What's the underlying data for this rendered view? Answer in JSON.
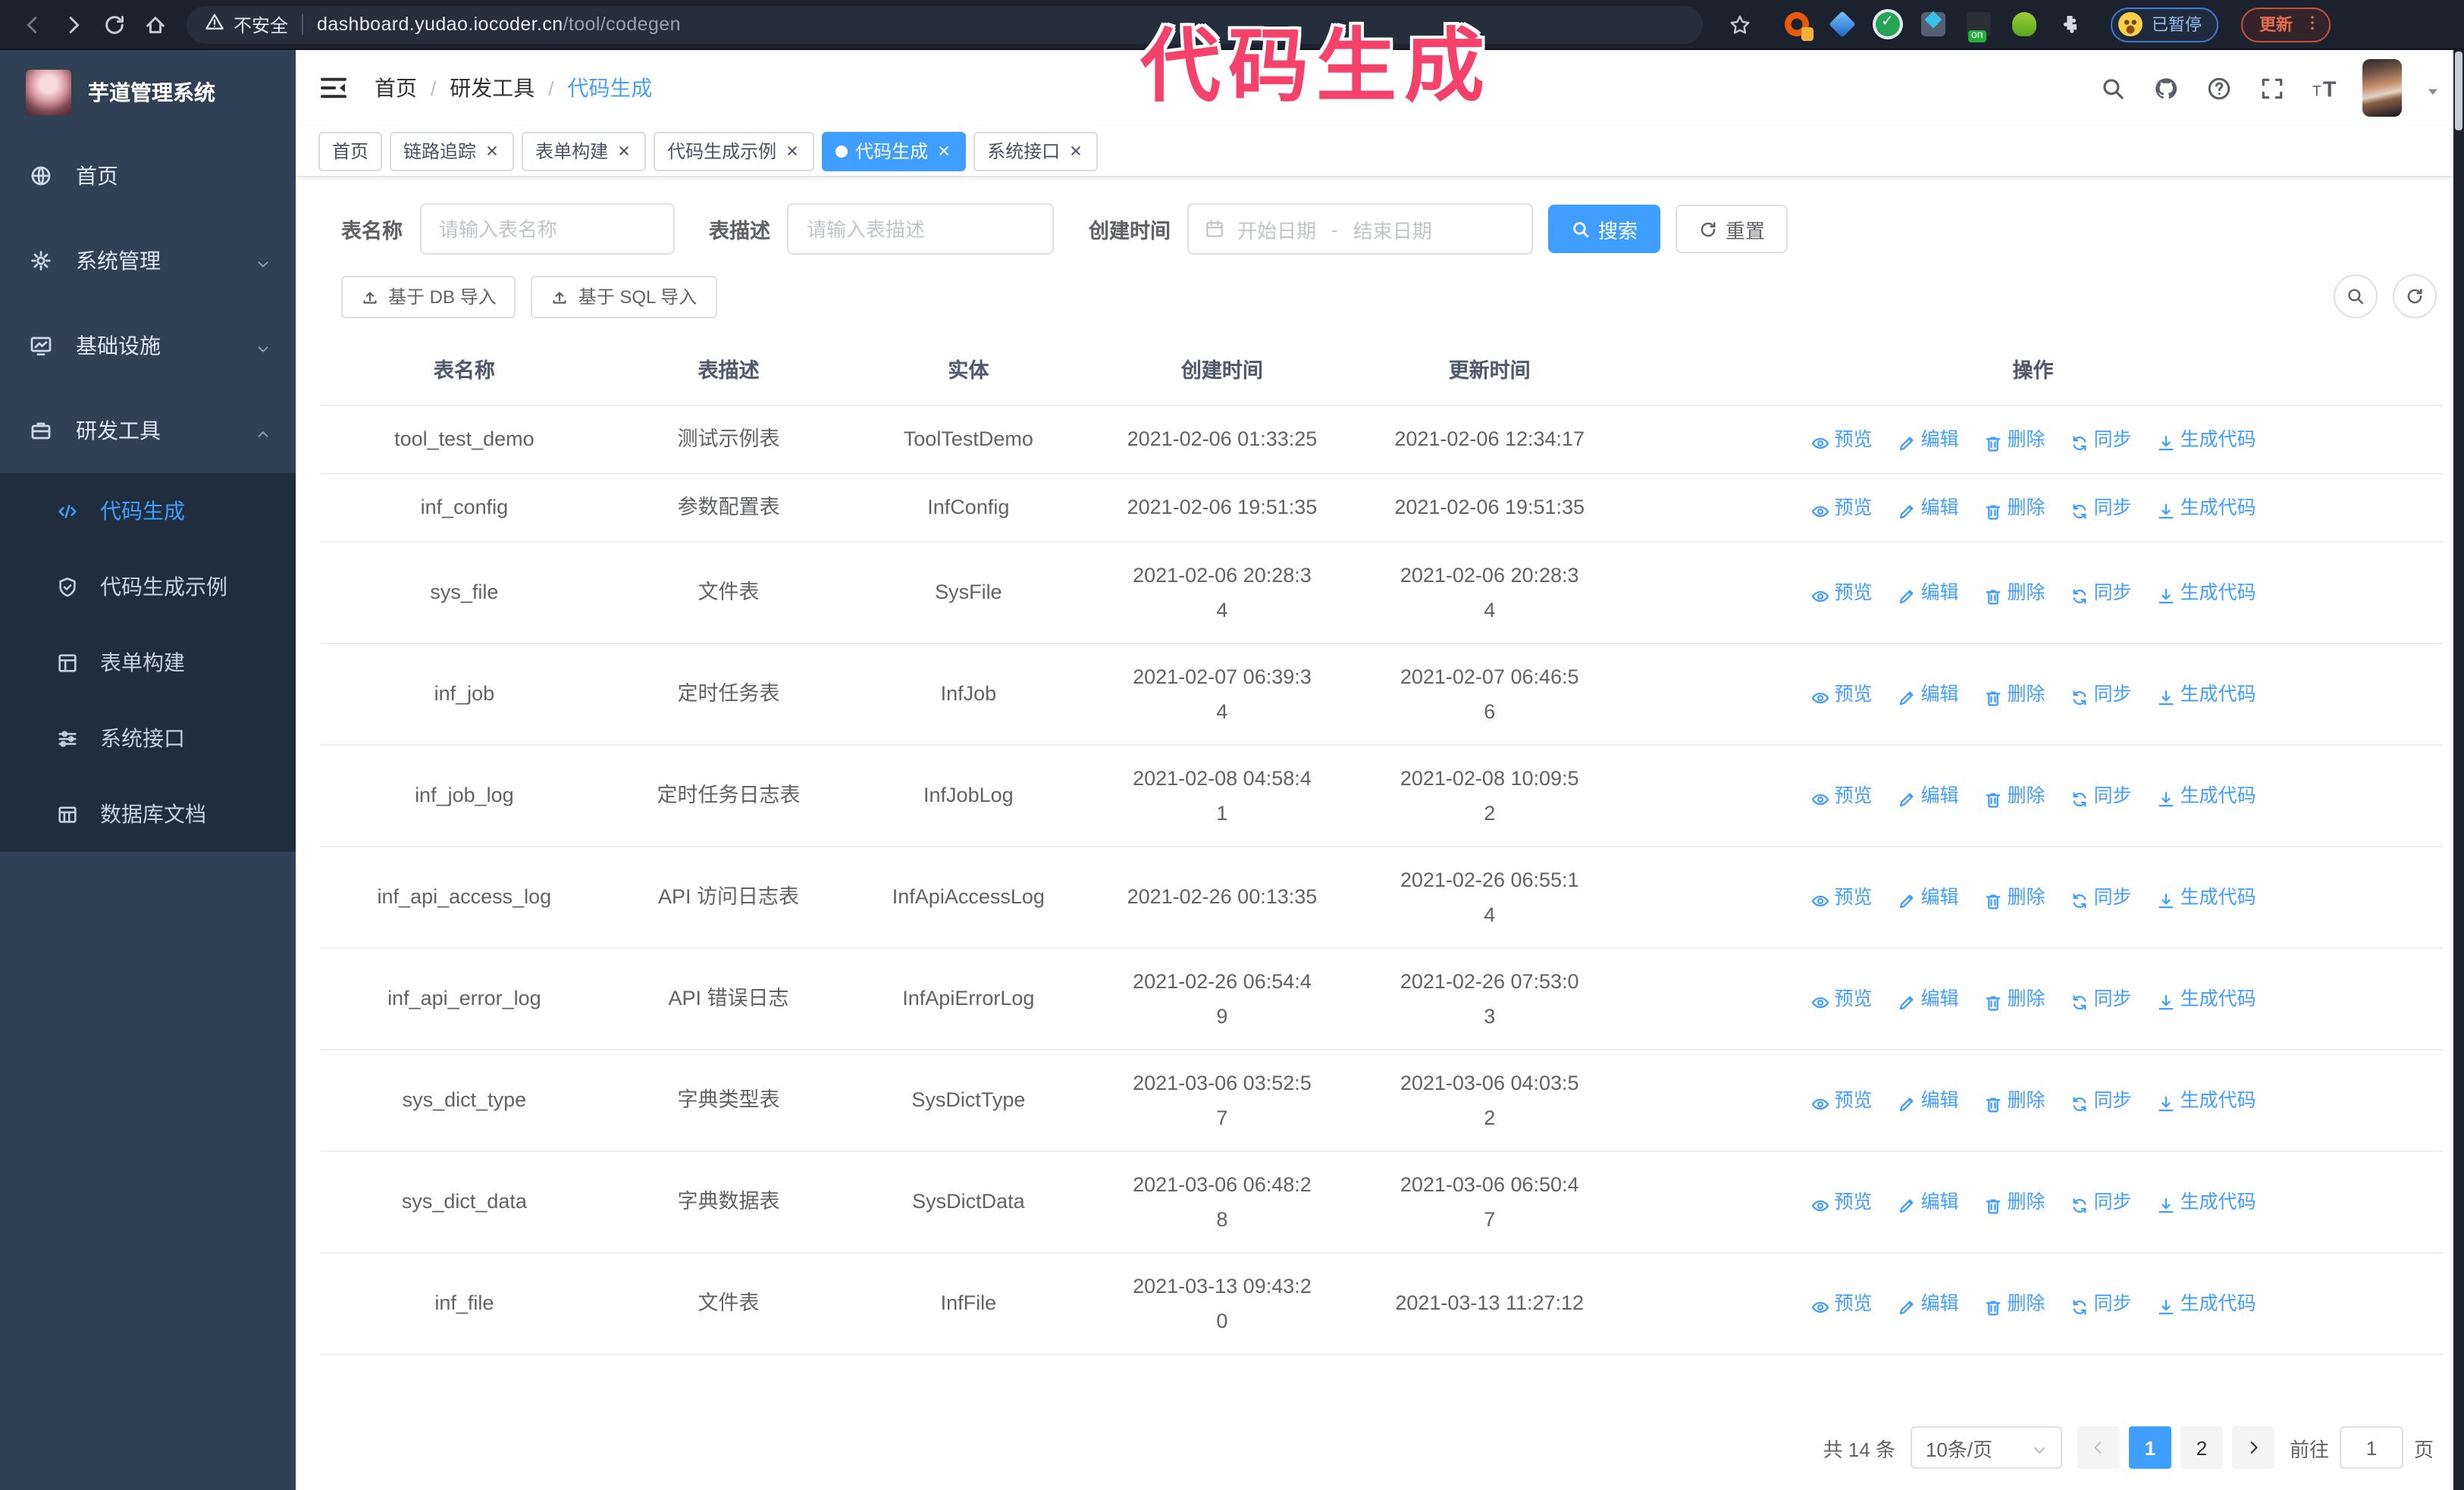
{
  "colors": {
    "accent": "#409eff",
    "annotation": "#f4426b",
    "sidebar_bg": "#304156",
    "submenu_bg": "#1f2d3d"
  },
  "annotation": {
    "text": "代码生成"
  },
  "browser": {
    "security_text": "不安全",
    "url_host": "dashboard.yudao.iocoder.cn",
    "url_path": "/tool/codegen",
    "paused_badge": "已暂停",
    "update_button": "更新"
  },
  "sidebar": {
    "app_title": "芋道管理系统",
    "items": [
      {
        "label": "首页",
        "icon": "dashboard-icon"
      },
      {
        "label": "系统管理",
        "icon": "gear-icon",
        "chevron": "down"
      },
      {
        "label": "基础设施",
        "icon": "infrastructure-icon",
        "chevron": "down"
      },
      {
        "label": "研发工具",
        "icon": "tools-icon",
        "chevron": "up",
        "expanded": true,
        "children": [
          {
            "label": "代码生成",
            "icon": "code-icon",
            "active": true
          },
          {
            "label": "代码生成示例",
            "icon": "shield-icon"
          },
          {
            "label": "表单构建",
            "icon": "form-icon"
          },
          {
            "label": "系统接口",
            "icon": "api-icon"
          },
          {
            "label": "数据库文档",
            "icon": "database-icon"
          }
        ]
      }
    ]
  },
  "navbar": {
    "breadcrumb": [
      "首页",
      "研发工具",
      "代码生成"
    ]
  },
  "tags": [
    {
      "label": "首页"
    },
    {
      "label": "链路追踪",
      "closable": true
    },
    {
      "label": "表单构建",
      "closable": true
    },
    {
      "label": "代码生成示例",
      "closable": true
    },
    {
      "label": "代码生成",
      "closable": true,
      "active": true
    },
    {
      "label": "系统接口",
      "closable": true
    }
  ],
  "filters": {
    "name_label": "表名称",
    "name_placeholder": "请输入表名称",
    "desc_label": "表描述",
    "desc_placeholder": "请输入表描述",
    "date_label": "创建时间",
    "date_start_placeholder": "开始日期",
    "date_separator": "-",
    "date_end_placeholder": "结束日期",
    "search_button": "搜索",
    "reset_button": "重置"
  },
  "toolbar": {
    "import_db_button": "基于 DB 导入",
    "import_sql_button": "基于 SQL 导入"
  },
  "table": {
    "headers": [
      "表名称",
      "表描述",
      "实体",
      "创建时间",
      "更新时间",
      "操作"
    ],
    "actions": [
      "预览",
      "编辑",
      "删除",
      "同步",
      "生成代码"
    ],
    "action_icons": [
      "eye-icon",
      "edit-icon",
      "delete-icon",
      "sync-icon",
      "download-icon"
    ],
    "rows": [
      {
        "name": "tool_test_demo",
        "desc": "测试示例表",
        "entity": "ToolTestDemo",
        "created": "2021-02-06 01:33:25",
        "updated": "2021-02-06 12:34:17"
      },
      {
        "name": "inf_config",
        "desc": "参数配置表",
        "entity": "InfConfig",
        "created": "2021-02-06 19:51:35",
        "updated": "2021-02-06 19:51:35"
      },
      {
        "name": "sys_file",
        "desc": "文件表",
        "entity": "SysFile",
        "created": "2021-02-06 20:28:3\n4",
        "updated": "2021-02-06 20:28:3\n4"
      },
      {
        "name": "inf_job",
        "desc": "定时任务表",
        "entity": "InfJob",
        "created": "2021-02-07 06:39:3\n4",
        "updated": "2021-02-07 06:46:5\n6"
      },
      {
        "name": "inf_job_log",
        "desc": "定时任务日志表",
        "entity": "InfJobLog",
        "created": "2021-02-08 04:58:4\n1",
        "updated": "2021-02-08 10:09:5\n2"
      },
      {
        "name": "inf_api_access_log",
        "desc": "API 访问日志表",
        "entity": "InfApiAccessLog",
        "created": "2021-02-26 00:13:35",
        "updated": "2021-02-26 06:55:1\n4"
      },
      {
        "name": "inf_api_error_log",
        "desc": "API 错误日志",
        "entity": "InfApiErrorLog",
        "created": "2021-02-26 06:54:4\n9",
        "updated": "2021-02-26 07:53:0\n3"
      },
      {
        "name": "sys_dict_type",
        "desc": "字典类型表",
        "entity": "SysDictType",
        "created": "2021-03-06 03:52:5\n7",
        "updated": "2021-03-06 04:03:5\n2"
      },
      {
        "name": "sys_dict_data",
        "desc": "字典数据表",
        "entity": "SysDictData",
        "created": "2021-03-06 06:48:2\n8",
        "updated": "2021-03-06 06:50:4\n7"
      },
      {
        "name": "inf_file",
        "desc": "文件表",
        "entity": "InfFile",
        "created": "2021-03-13 09:43:2\n0",
        "updated": "2021-03-13 11:27:12"
      }
    ]
  },
  "pagination": {
    "total": "共 14 条",
    "page_size": "10条/页",
    "pages": [
      "1",
      "2"
    ],
    "current": "1",
    "goto_label": "前往",
    "goto_value": "1",
    "goto_suffix": "页"
  }
}
